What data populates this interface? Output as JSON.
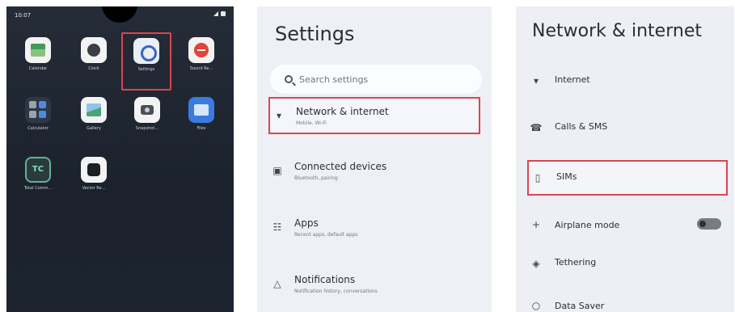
{
  "home": {
    "status_time": "10:07",
    "apps": [
      {
        "label": "Calendar",
        "icon": "calendar-icon"
      },
      {
        "label": "Clock",
        "icon": "clock-icon"
      },
      {
        "label": "Settings",
        "icon": "settings-icon"
      },
      {
        "label": "Sound Re...",
        "icon": "sound-recorder-icon"
      },
      {
        "label": "Calculator",
        "icon": "calculator-icon"
      },
      {
        "label": "Gallery",
        "icon": "gallery-icon"
      },
      {
        "label": "Snapshot...",
        "icon": "camera-icon"
      },
      {
        "label": "Files",
        "icon": "files-icon"
      },
      {
        "label": "Total Comm...",
        "icon": "total-commander-icon"
      },
      {
        "label": "Vector Re...",
        "icon": "vector-icon"
      }
    ]
  },
  "settings": {
    "title": "Settings",
    "search_placeholder": "Search settings",
    "items": [
      {
        "title": "Network & internet",
        "subtitle": "Mobile, Wi-Fi",
        "icon": "wifi-icon"
      },
      {
        "title": "Connected devices",
        "subtitle": "Bluetooth, pairing",
        "icon": "devices-icon"
      },
      {
        "title": "Apps",
        "subtitle": "Recent apps, default apps",
        "icon": "apps-icon"
      },
      {
        "title": "Notifications",
        "subtitle": "Notification history, conversations",
        "icon": "bell-icon"
      }
    ]
  },
  "network": {
    "title": "Network & internet",
    "items": [
      {
        "title": "Internet",
        "subtitle": "",
        "icon": "wifi-icon"
      },
      {
        "title": "Calls & SMS",
        "subtitle": "",
        "icon": "calls-icon"
      },
      {
        "title": "SIMs",
        "subtitle": "",
        "icon": "sim-icon"
      },
      {
        "title": "Airplane mode",
        "subtitle": "",
        "icon": "airplane-icon"
      },
      {
        "title": "Tethering",
        "subtitle": "",
        "icon": "tethering-icon"
      },
      {
        "title": "Data Saver",
        "subtitle": "",
        "icon": "data-saver-icon"
      }
    ]
  },
  "colors": {
    "highlight": "#d9464f",
    "settings_bg": "#eef0f6",
    "home_bg": "#252c38"
  }
}
